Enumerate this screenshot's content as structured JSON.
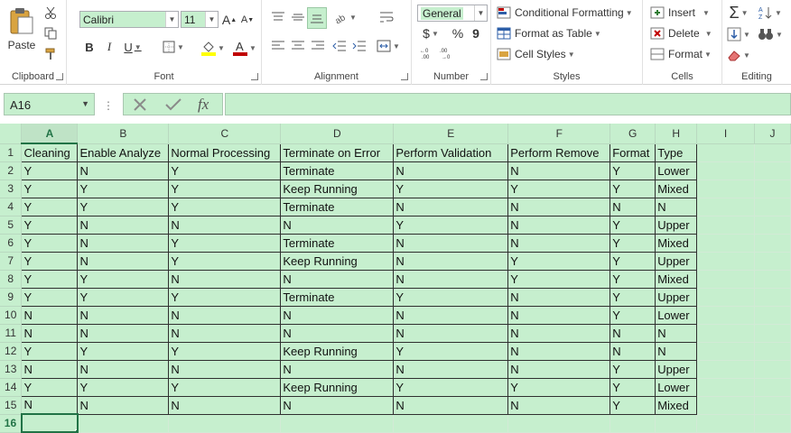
{
  "ribbon": {
    "clipboard": {
      "label": "Clipboard",
      "paste_label": "Paste"
    },
    "font": {
      "label": "Font",
      "font_name": "Calibri",
      "font_size": "11",
      "bold": "B",
      "italic": "I",
      "underline": "U",
      "grow": "A",
      "shrink": "A"
    },
    "alignment": {
      "label": "Alignment"
    },
    "number": {
      "label": "Number",
      "format": "General",
      "currency": "$",
      "percent": "%",
      "comma": "9"
    },
    "styles": {
      "label": "Styles",
      "conditional": "Conditional Formatting",
      "format_table": "Format as Table",
      "cell_styles": "Cell Styles"
    },
    "cells": {
      "label": "Cells",
      "insert": "Insert",
      "delete": "Delete",
      "format": "Format"
    },
    "editing": {
      "label": "Editing",
      "sum": "Σ"
    }
  },
  "formula_bar": {
    "name_box": "A16",
    "fx": "fx",
    "formula": ""
  },
  "sheet": {
    "columns": [
      "A",
      "B",
      "C",
      "D",
      "E",
      "F",
      "G",
      "H",
      "I",
      "J"
    ],
    "selected_column": "A",
    "selected_row": "16",
    "header_row": [
      "Cleaning",
      "Enable Analyze",
      "Normal Processing",
      "Terminate on Error",
      "Perform Validation",
      "Perform Remove",
      "Format",
      "Type"
    ],
    "rows": [
      [
        "Y",
        "N",
        "Y",
        "Terminate",
        "N",
        "N",
        "Y",
        "Lower"
      ],
      [
        "Y",
        "Y",
        "Y",
        "Keep Running",
        "Y",
        "Y",
        "Y",
        "Mixed"
      ],
      [
        "Y",
        "Y",
        "Y",
        "Terminate",
        "N",
        "N",
        "N",
        "N"
      ],
      [
        "Y",
        "N",
        "N",
        "N",
        "Y",
        "N",
        "Y",
        "Upper"
      ],
      [
        "Y",
        "N",
        "Y",
        "Terminate",
        "N",
        "N",
        "Y",
        "Mixed"
      ],
      [
        "Y",
        "N",
        "Y",
        "Keep Running",
        "N",
        "Y",
        "Y",
        "Upper"
      ],
      [
        "Y",
        "Y",
        "N",
        "N",
        "N",
        "Y",
        "Y",
        "Mixed"
      ],
      [
        "Y",
        "Y",
        "Y",
        "Terminate",
        "Y",
        "N",
        "Y",
        "Upper"
      ],
      [
        "N",
        "N",
        "N",
        "N",
        "N",
        "N",
        "Y",
        "Lower"
      ],
      [
        "N",
        "N",
        "N",
        "N",
        "N",
        "N",
        "N",
        "N"
      ],
      [
        "Y",
        "Y",
        "Y",
        "Keep Running",
        "Y",
        "N",
        "N",
        "N"
      ],
      [
        "N",
        "N",
        "N",
        "N",
        "N",
        "N",
        "Y",
        "Upper"
      ],
      [
        "Y",
        "Y",
        "Y",
        "Keep Running",
        "Y",
        "Y",
        "Y",
        "Lower"
      ],
      [
        "N",
        "N",
        "N",
        "N",
        "N",
        "N",
        "Y",
        "Mixed"
      ]
    ],
    "row_numbers": [
      "1",
      "2",
      "3",
      "4",
      "5",
      "6",
      "7",
      "8",
      "9",
      "10",
      "11",
      "12",
      "13",
      "14",
      "15",
      "16"
    ]
  },
  "colors": {
    "accent": "#217346",
    "cell_fill": "#c6efce"
  }
}
